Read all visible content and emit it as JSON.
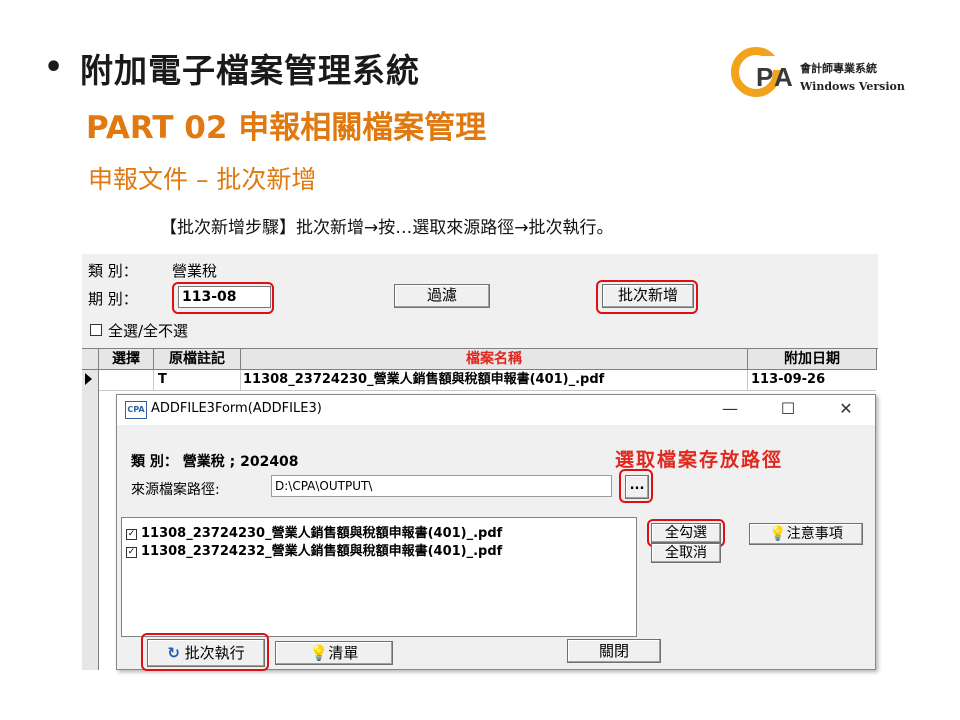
{
  "slide": {
    "bullet": "•",
    "title": "附加電子檔案管理系統",
    "part": "PART 02 申報相關檔案管理",
    "subtitle": "申報文件 – 批次新增",
    "steps": "【批次新增步驟】批次新增→按…選取來源路徑→批次執行。"
  },
  "logo": {
    "mark": "CPA",
    "line1": "會計師專業系統",
    "line2": "Windows Version"
  },
  "main": {
    "category_label": "類 別：",
    "category_value": "營業稅",
    "period_label": "期 別：",
    "period_value": "113-08",
    "filter_button": "過濾",
    "batch_add_button": "批次新增",
    "select_all_label": "全選/全不選",
    "grid": {
      "columns": [
        "選擇",
        "原檔註記",
        "檔案名稱",
        "附加日期"
      ],
      "rows": [
        {
          "select": "",
          "note": "T",
          "name": "11308_23724230_營業人銷售額與稅額申報書(401)_.pdf",
          "date": "113-09-26"
        }
      ]
    }
  },
  "dialog": {
    "caption": "ADDFILE3Form(ADDFILE3)",
    "icon": "CPA",
    "minimize": "—",
    "maximize": "☐",
    "close": "✕",
    "info": "類 別： 營業稅 ; 202408",
    "hint": "選取檔案存放路徑",
    "path_label": "來源檔案路徑:",
    "path_value": "D:\\CPA\\OUTPUT\\",
    "browse_button": "...",
    "files": [
      "11308_23724230_營業人銷售額與稅額申報書(401)_.pdf",
      "11308_23724232_營業人銷售額與稅額申報書(401)_.pdf"
    ],
    "select_all_button": "全勾選",
    "deselect_all_button": "全取消",
    "notes_button": "注意事項",
    "run_button": "批次執行",
    "list_button": "清單",
    "close_button": "關閉"
  }
}
